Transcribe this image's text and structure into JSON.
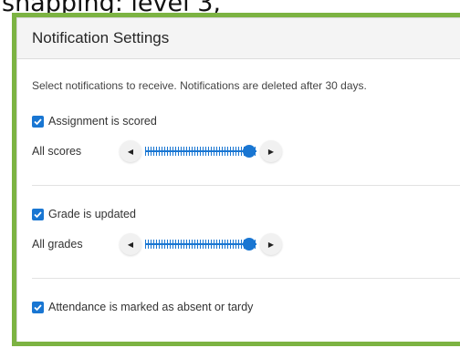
{
  "caption": "snapping: level 3,",
  "header": {
    "title": "Notification Settings"
  },
  "description": "Select notifications to receive. Notifications are deleted after 30 days.",
  "settings": [
    {
      "label": "Assignment is scored",
      "checked": true,
      "slider": {
        "label": "All scores",
        "level": 1.0,
        "left_glyph": "◀",
        "right_glyph": "▶"
      }
    },
    {
      "label": "Grade is updated",
      "checked": true,
      "slider": {
        "label": "All grades",
        "level": 1.0,
        "left_glyph": "◀",
        "right_glyph": "▶"
      }
    },
    {
      "label": "Attendance is marked as absent or tardy",
      "checked": true
    }
  ],
  "colors": {
    "accent": "#1976d2",
    "frame": "#7cb342"
  }
}
